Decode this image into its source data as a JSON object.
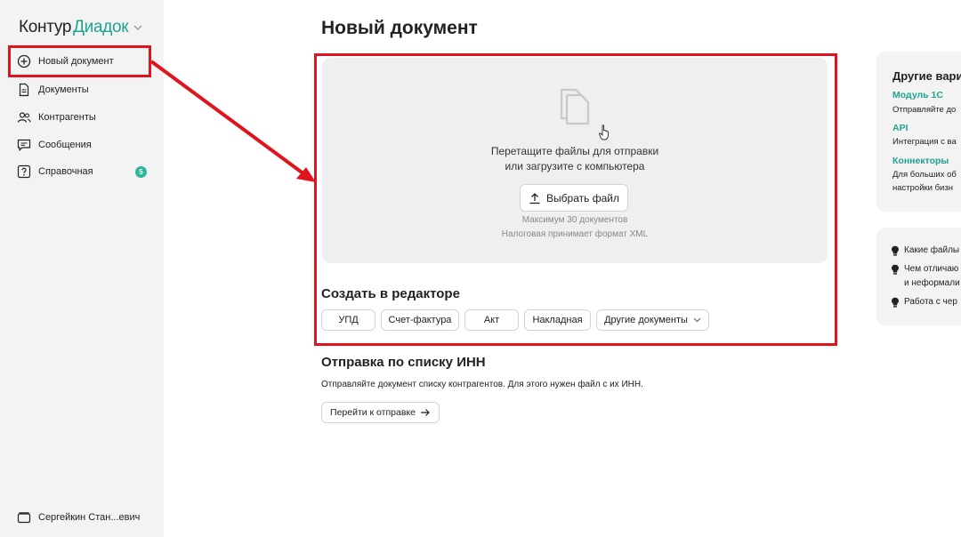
{
  "logo": {
    "part1": "Контур",
    "part2": "Диадок"
  },
  "sidebar": {
    "items": [
      {
        "label": "Новый документ",
        "icon": "plus-circle-icon"
      },
      {
        "label": "Документы",
        "icon": "document-icon"
      },
      {
        "label": "Контрагенты",
        "icon": "users-icon"
      },
      {
        "label": "Сообщения",
        "icon": "message-icon"
      },
      {
        "label": "Справочная",
        "icon": "help-icon",
        "badge": "5"
      }
    ],
    "user": "Сергейкин Стан...евич"
  },
  "main": {
    "title": "Новый документ",
    "dropzone": {
      "line1": "Перетащите файлы для отправки",
      "line2": "или загрузите с компьютера",
      "button": "Выбрать файл",
      "hint1": "Максимум 30 документов",
      "hint2": "Налоговая принимает формат XML"
    },
    "editor": {
      "title": "Создать в редакторе",
      "chips": [
        "УПД",
        "Счет-фактура",
        "Акт",
        "Накладная",
        "Другие документы"
      ]
    },
    "inn": {
      "title": "Отправка по списку ИНН",
      "desc": "Отправляйте документ списку контрагентов. Для этого нужен файл с их ИНН.",
      "button": "Перейти к отправке"
    }
  },
  "right": {
    "card_title": "Другие вари",
    "options": [
      {
        "link": "Модуль 1С",
        "desc": "Отправляйте до"
      },
      {
        "link": "API",
        "desc": "Интеграция с ва"
      },
      {
        "link": "Коннекторы",
        "desc": "Для больших об",
        "desc2": "настройки бизн"
      }
    ],
    "tips": [
      {
        "line1": "Какие файлы"
      },
      {
        "line1": "Чем отличаю",
        "line2": "и неформали"
      },
      {
        "line1": "Работа с чер"
      }
    ]
  },
  "colors": {
    "accent": "#1fa38f",
    "annotation": "#e0141d",
    "badge": "#2bb59b"
  }
}
